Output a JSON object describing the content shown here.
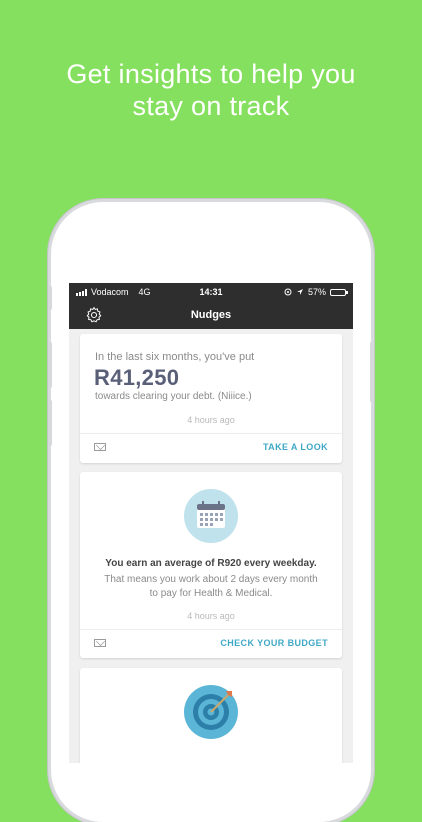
{
  "headline": {
    "line1": "Get insights to help you",
    "line2": "stay on track"
  },
  "statusbar": {
    "carrier": "Vodacom",
    "network": "4G",
    "time": "14:31",
    "battery": "57%",
    "battery_level": 0.57
  },
  "navbar": {
    "title": "Nudges",
    "settings_icon": "gear-icon"
  },
  "card1": {
    "lead": "In the last six months, you've put",
    "amount": "R41,250",
    "sub": "towards clearing your debt. (Niiice.)",
    "time": "4 hours ago",
    "action": "TAKE A LOOK"
  },
  "card2": {
    "icon": "calendar-icon",
    "bold": "You earn an average of R920 every weekday.",
    "line1": "That means you work about 2 days every month",
    "line2": "to pay for Health & Medical.",
    "time": "4 hours ago",
    "action": "CHECK YOUR BUDGET"
  },
  "card3": {
    "icon": "target-icon"
  },
  "colors": {
    "background": "#86e05f",
    "accent": "#3fa8c6",
    "bar": "#2e2e2e",
    "icon_bg": "#bfe2ec"
  }
}
